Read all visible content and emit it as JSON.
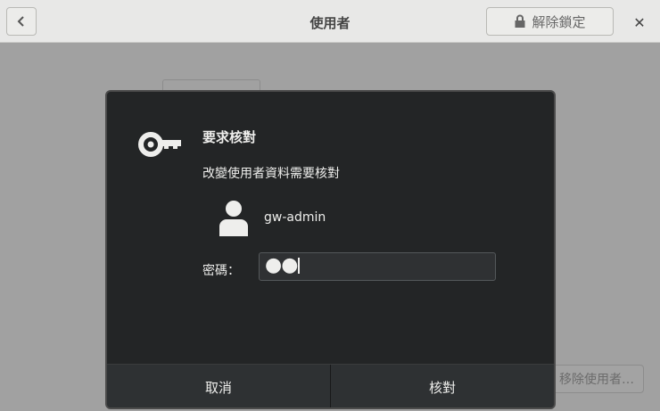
{
  "window": {
    "title": "使用者",
    "unlock_label": "解除鎖定",
    "remove_user_label": "移除使用者…"
  },
  "dialog": {
    "heading": "要求核對",
    "message": "改變使用者資料需要核對",
    "username": "gw-admin",
    "password_label": "密碼：",
    "password_value": "●●",
    "cancel_label": "取消",
    "authenticate_label": "核對"
  },
  "icons": {
    "back": "chevron-left-icon",
    "lock": "lock-icon",
    "close": "close-icon",
    "key": "key-icon",
    "user": "user-avatar-icon"
  },
  "colors": {
    "dialog_bg": "#232526",
    "text": "#eeeeec",
    "titlebar": "#e8e8e7"
  }
}
